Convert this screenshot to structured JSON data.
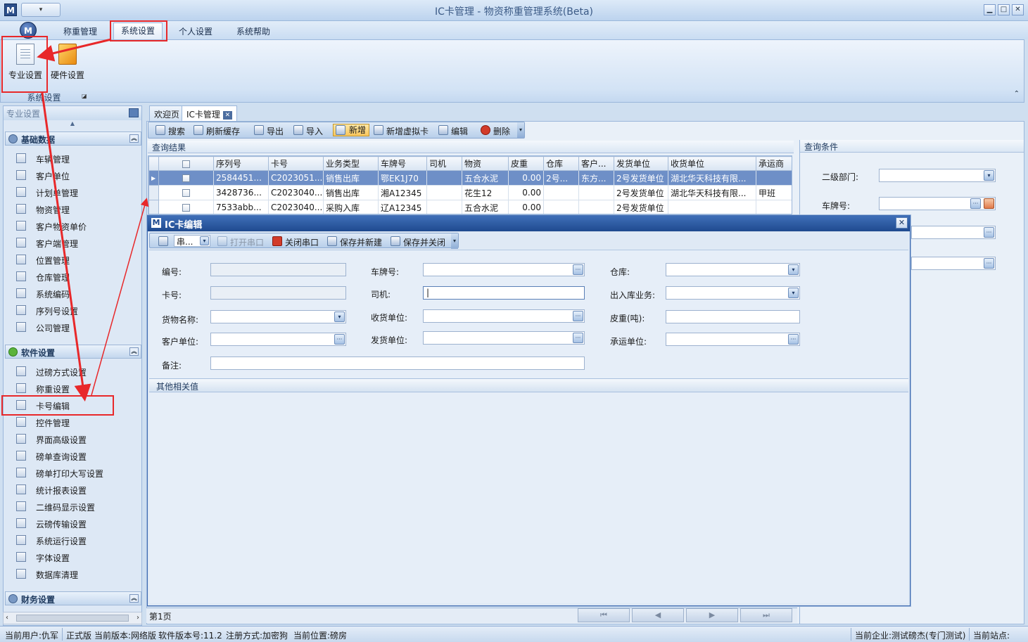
{
  "window": {
    "logo": "M",
    "quick_access": "▾",
    "title": "IC卡管理 - 物资称重管理系统(Beta)",
    "min": "▁",
    "max": "□",
    "close": "✕"
  },
  "menu": {
    "app_button": "M",
    "items": [
      "称重管理",
      "系统设置",
      "个人设置",
      "系统帮助"
    ]
  },
  "ribbon": {
    "buttons": [
      "专业设置",
      "硬件设置"
    ],
    "group_label": "系统设置",
    "collapse": "⌃"
  },
  "sidebar": {
    "header": "专业设置",
    "sections": [
      {
        "title": "基础数据",
        "items": [
          "车辆管理",
          "客户单位",
          "计划单管理",
          "物资管理",
          "客户物资单价",
          "客户端管理",
          "位置管理",
          "仓库管理",
          "系统编码",
          "序列号设置",
          "公司管理"
        ]
      },
      {
        "title": "软件设置",
        "items": [
          "过磅方式设置",
          "称重设置",
          "卡号编辑",
          "控件管理",
          "界面高级设置",
          "磅单查询设置",
          "磅单打印大写设置",
          "统计报表设置",
          "二维码显示设置",
          "云磅传输设置",
          "系统运行设置",
          "字体设置",
          "数据库清理"
        ]
      },
      {
        "title": "财务设置",
        "items": []
      }
    ]
  },
  "tabs": [
    {
      "label": "欢迎页"
    },
    {
      "label": "IC卡管理"
    }
  ],
  "toolbar": {
    "items": [
      "搜索",
      "刷新缓存",
      "导出",
      "导入",
      "新增",
      "新增虚拟卡",
      "编辑",
      "删除"
    ]
  },
  "results": {
    "title": "查询结果",
    "columns": [
      "序列号",
      "卡号",
      "业务类型",
      "车牌号",
      "司机",
      "物资",
      "皮重",
      "仓库",
      "客户...",
      "发货单位",
      "收货单位",
      "承运商"
    ],
    "rows": [
      [
        "2584451...",
        "C2023051...",
        "销售出库",
        "鄂EK1J70",
        "",
        "五合水泥",
        "0.00",
        "2号...",
        "东方...",
        "2号发货单位",
        "湖北华天科技有限...",
        ""
      ],
      [
        "3428736...",
        "C2023040...",
        "销售出库",
        "湘A12345",
        "",
        "花生12",
        "0.00",
        "",
        "",
        "2号发货单位",
        "湖北华天科技有限...",
        "甲班"
      ],
      [
        "7533abb...",
        "C2023040...",
        "采购入库",
        "辽A12345",
        "",
        "五合水泥",
        "0.00",
        "",
        "",
        "2号发货单位",
        "",
        ""
      ]
    ]
  },
  "query": {
    "title": "查询条件",
    "labels": [
      "二级部门:",
      "车牌号:"
    ]
  },
  "pager": {
    "page_label": "第1页",
    "nav": [
      "⏮",
      "◀",
      "▶",
      "⏭"
    ]
  },
  "dialog": {
    "logo": "M",
    "title": "IC卡编辑",
    "close": "✕",
    "toolbar": {
      "port_select": "串...",
      "open_port": "打开串口",
      "close_port": "关闭串口",
      "save_new": "保存并新建",
      "save_close": "保存并关闭"
    },
    "fields": {
      "code": "编号:",
      "card": "卡号:",
      "goods": "货物名称:",
      "customer": "客户单位:",
      "remark": "备注:",
      "plate": "车牌号:",
      "driver": "司机:",
      "receiver": "收货单位:",
      "sender": "发货单位:",
      "warehouse": "仓库:",
      "inout": "出入库业务:",
      "tare": "皮重(吨):",
      "carrier": "承运单位:"
    },
    "other_section": "其他相关值"
  },
  "statusbar": {
    "user": "当前用户:仇军",
    "edition": "正式版",
    "version_type": "当前版本:网络版",
    "version_no": "软件版本号:11.2",
    "reg": "注册方式:加密狗",
    "location": "当前位置:磅房",
    "company": "当前企业:测试磅杰(专门测试)",
    "station": "当前站点:"
  },
  "colors": {
    "annotation": "#e8282a",
    "accent": "#3f6fb8"
  }
}
